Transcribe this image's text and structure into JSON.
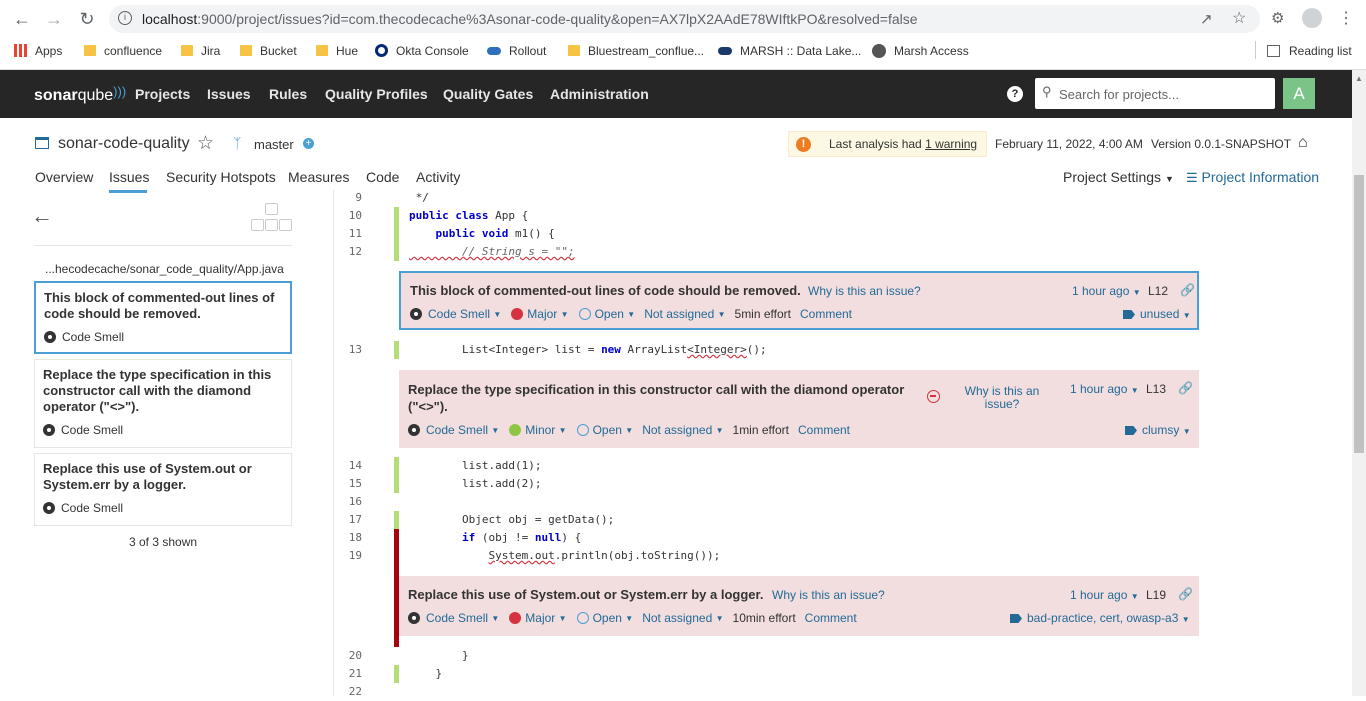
{
  "browser": {
    "url_host": "localhost",
    "url_rest": ":9000/project/issues?id=com.thecodecache%3Asonar-code-quality&open=AX7lpX2AAdE78WIftkPO&resolved=false",
    "bookmarks": [
      "Apps",
      "confluence",
      "Jira",
      "Bucket",
      "Hue",
      "Okta Console",
      "Rollout",
      "Bluestream_conflue...",
      "MARSH :: Data Lake...",
      "Marsh Access"
    ],
    "reading_list": "Reading list"
  },
  "header": {
    "logo_bold": "sonar",
    "logo_rest": "qube",
    "nav": [
      "Projects",
      "Issues",
      "Rules",
      "Quality Profiles",
      "Quality Gates",
      "Administration"
    ],
    "search_placeholder": "Search for projects...",
    "avatar_letter": "A"
  },
  "project": {
    "name": "sonar-code-quality",
    "branch": "master",
    "warning_prefix": "Last analysis had ",
    "warning_link": "1 warning",
    "date": "February 11, 2022, 4:00 AM",
    "version": "Version 0.0.1-SNAPSHOT",
    "tabs": [
      "Overview",
      "Issues",
      "Security Hotspots",
      "Measures",
      "Code",
      "Activity"
    ],
    "settings": "Project Settings",
    "info": "Project Information"
  },
  "sidebar": {
    "file_path": "...hecodecache/sonar_code_quality/App.java",
    "issues": [
      {
        "title": "This block of commented-out lines of code should be removed.",
        "type": "Code Smell"
      },
      {
        "title": "Replace the type specification in this constructor call with the diamond operator (\"<>\").",
        "type": "Code Smell"
      },
      {
        "title": "Replace this use of System.out or System.err by a logger.",
        "type": "Code Smell"
      }
    ],
    "count": "3 of 3 shown"
  },
  "code": {
    "lines": [
      {
        "n": "9",
        "text": " */"
      },
      {
        "n": "10",
        "text": "public class App {"
      },
      {
        "n": "11",
        "text": "    public void m1() {"
      },
      {
        "n": "12",
        "text": "        // String s = \"\";"
      },
      {
        "n": "13",
        "text": "        List<Integer> list = new ArrayList<Integer>();"
      },
      {
        "n": "14",
        "text": "        list.add(1);"
      },
      {
        "n": "15",
        "text": "        list.add(2);"
      },
      {
        "n": "16",
        "text": ""
      },
      {
        "n": "17",
        "text": "        Object obj = getData();"
      },
      {
        "n": "18",
        "text": "        if (obj != null) {"
      },
      {
        "n": "19",
        "text": "            System.out.println(obj.toString());"
      },
      {
        "n": "20",
        "text": "        }"
      },
      {
        "n": "21",
        "text": "    }"
      },
      {
        "n": "22",
        "text": ""
      }
    ]
  },
  "issues": [
    {
      "title": "This block of commented-out lines of code should be removed.",
      "why": "Why is this an issue?",
      "ago": "1 hour ago",
      "line": "L12",
      "type": "Code Smell",
      "severity": "Major",
      "status": "Open",
      "assignee": "Not assigned",
      "effort": "5min effort",
      "comment": "Comment",
      "tags": "unused"
    },
    {
      "title_l1": "Replace the type specification in this constructor call with the diamond operator",
      "title_l2": "(\"<>\").",
      "why_l1": "Why is this an",
      "why_l2": "issue?",
      "ago": "1 hour ago",
      "line": "L13",
      "type": "Code Smell",
      "severity": "Minor",
      "status": "Open",
      "assignee": "Not assigned",
      "effort": "1min effort",
      "comment": "Comment",
      "tags": "clumsy"
    },
    {
      "title": "Replace this use of System.out or System.err by a logger.",
      "why": "Why is this an issue?",
      "ago": "1 hour ago",
      "line": "L19",
      "type": "Code Smell",
      "severity": "Major",
      "status": "Open",
      "assignee": "Not assigned",
      "effort": "10min effort",
      "comment": "Comment",
      "tags": "bad-practice, cert, owasp-a3"
    }
  ]
}
